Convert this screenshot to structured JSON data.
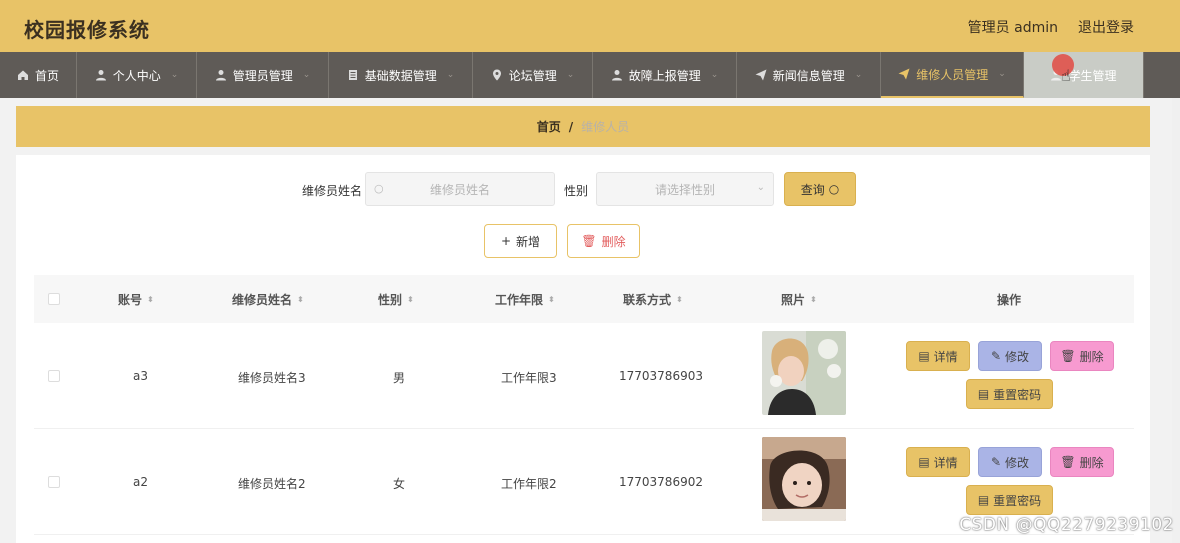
{
  "header": {
    "title": "校园报修系统",
    "user": "管理员 admin",
    "logout": "退出登录"
  },
  "nav": [
    {
      "label": "首页",
      "icon": "home-icon"
    },
    {
      "label": "个人中心",
      "icon": "user-icon"
    },
    {
      "label": "管理员管理",
      "icon": "user-icon"
    },
    {
      "label": "基础数据管理",
      "icon": "list-icon"
    },
    {
      "label": "论坛管理",
      "icon": "pin-icon"
    },
    {
      "label": "故障上报管理",
      "icon": "user-icon"
    },
    {
      "label": "新闻信息管理",
      "icon": "send-icon"
    },
    {
      "label": "维修人员管理",
      "icon": "send-icon"
    },
    {
      "label": "学生管理",
      "icon": "user-icon"
    }
  ],
  "breadcrumb": {
    "home": "首页",
    "separator": "/",
    "current": "维修人员"
  },
  "search": {
    "name_label": "维修员姓名",
    "name_placeholder": "维修员姓名",
    "gender_label": "性别",
    "gender_placeholder": "请选择性别",
    "query_button": "查询"
  },
  "actions": {
    "add": "新增",
    "delete": "删除"
  },
  "table": {
    "columns": [
      "账号",
      "维修员姓名",
      "性别",
      "工作年限",
      "联系方式",
      "照片",
      "操作"
    ],
    "rows": [
      {
        "account": "a3",
        "name": "维修员姓名3",
        "gender": "男",
        "years": "工作年限3",
        "phone": "17703786903"
      },
      {
        "account": "a2",
        "name": "维修员姓名2",
        "gender": "女",
        "years": "工作年限2",
        "phone": "17703786902"
      }
    ],
    "row_actions": {
      "detail": "详情",
      "edit": "修改",
      "remove": "删除",
      "reset": "重置密码"
    }
  },
  "watermark": "CSDN @QQ2279239102",
  "colors": {
    "accent": "#e8c367",
    "nav_bg": "#5f5b57",
    "edit": "#aab4e6",
    "remove": "#f79ad0"
  }
}
